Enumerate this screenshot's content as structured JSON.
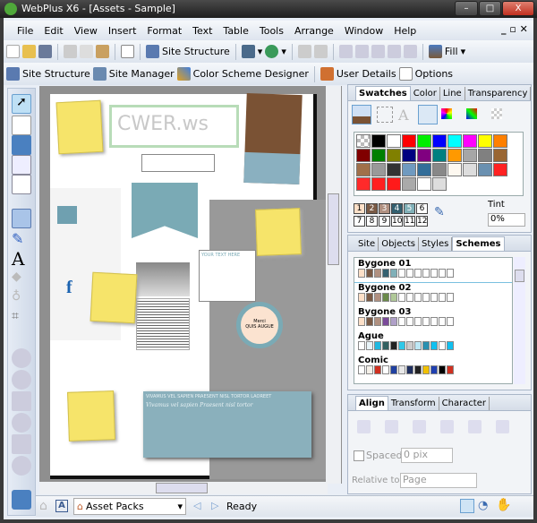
{
  "window": {
    "title": "WebPlus X6 - [Assets - Sample]",
    "minimize": "–",
    "maximize": "□",
    "close": "X"
  },
  "menu": [
    "File",
    "Edit",
    "View",
    "Insert",
    "Format",
    "Text",
    "Table",
    "Tools",
    "Arrange",
    "Window",
    "Help"
  ],
  "toolbar1": {
    "site_structure": "Site Structure",
    "fill": "Fill"
  },
  "toolbar2": {
    "site_structure": "Site Structure",
    "site_manager": "Site Manager",
    "color_scheme_designer": "Color Scheme Designer",
    "user_details": "User Details",
    "options": "Options"
  },
  "canvas": {
    "logo_text": "CWER.ws",
    "text_frame_heading": "YOUR TEXT HERE",
    "badge_title": "Merci",
    "badge_text": "QUIS AUGUE",
    "banner_heading": "VIVAMUS VEL SAPIEN PRAESENT NISL TORTOR LAOREET",
    "banner_script": "Vivamus vel sapien Praesent nisl tortor"
  },
  "swatches": {
    "tabs": [
      "Swatches",
      "Color",
      "Line",
      "Transparency"
    ],
    "colors": [
      "checker",
      "#000000",
      "#ffffff",
      "#ff0000",
      "#00ee00",
      "#0000ff",
      "#00ffff",
      "#ff00ff",
      "#ffff00",
      "#ff8000",
      "#800000",
      "#008000",
      "#808000",
      "#000080",
      "#800080",
      "#008080",
      "#ff9900",
      "#a6a6a6",
      "#808080",
      "#996633",
      "#a0704a",
      "#999999",
      "#333333",
      "#6f9ac0",
      "#336e99",
      "#888888",
      "#fdf8f0",
      "#dddddd",
      "#6a90b0",
      "#ff2222",
      "#ff2a2a",
      "#ff2020",
      "#ff1a1a",
      "#aaaaaa",
      "#ffffff",
      "#dddddd"
    ],
    "scheme_numbers": [
      "1",
      "2",
      "3",
      "4",
      "5",
      "6",
      "7",
      "8",
      "9",
      "10",
      "11",
      "12"
    ],
    "scheme_number_colors": [
      "#fde0c8",
      "#7a5a45",
      "#b09080",
      "#336070",
      "#80b0b8",
      "#ffffff",
      "#ffffff",
      "#ffffff",
      "#ffffff",
      "#ffffff",
      "#ffffff",
      "#ffffff"
    ],
    "tint_label": "Tint",
    "tint_value": "0%"
  },
  "schemes": {
    "tabs": [
      "Site",
      "Objects",
      "Styles",
      "Schemes"
    ],
    "items": [
      {
        "name": "Bygone 01",
        "colors": [
          "#fde0c8",
          "#7a5a45",
          "#b09080",
          "#336070",
          "#80b0b8",
          "#fff",
          "#fff",
          "#fff",
          "#fff",
          "#fff",
          "#fff",
          "#fff"
        ]
      },
      {
        "name": "Bygone 02",
        "colors": [
          "#fde0c8",
          "#7a5a45",
          "#b09080",
          "#6a8a4a",
          "#b0c898",
          "#fff",
          "#fff",
          "#fff",
          "#fff",
          "#fff",
          "#fff",
          "#fff"
        ]
      },
      {
        "name": "Bygone 03",
        "colors": [
          "#fde0c8",
          "#7a5a45",
          "#b09080",
          "#7a4a9a",
          "#b0a0c8",
          "#fff",
          "#fff",
          "#fff",
          "#fff",
          "#fff",
          "#fff",
          "#fff"
        ]
      },
      {
        "name": "Ague",
        "colors": [
          "#ffffff",
          "#e8f4f8",
          "#20b8e0",
          "#336060",
          "#222222",
          "#30c8e8",
          "#cccccc",
          "#bde8f5",
          "#2a90b0",
          "#10c0f0",
          "#ffffff",
          "#10c0f0"
        ]
      },
      {
        "name": "Comic",
        "colors": [
          "#ffffff",
          "#f5f0e8",
          "#d03020",
          "#ffffff",
          "#2040a0",
          "#e8e8e8",
          "#203060",
          "#222222",
          "#f0c000",
          "#2040b0",
          "#000000",
          "#d03020"
        ]
      }
    ]
  },
  "align": {
    "tabs": [
      "Align",
      "Transform",
      "Character"
    ],
    "spaced_label": "Spaced",
    "spacing_value": "0 pix",
    "relative_label": "Relative to:",
    "relative_value": "Page"
  },
  "status": {
    "asset_packs": "Asset Packs",
    "state": "Ready"
  }
}
